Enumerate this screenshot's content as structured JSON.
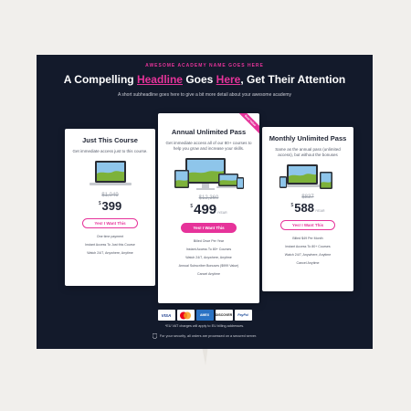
{
  "header": {
    "eyebrow": "AWESOME ACADEMY NAME GOES HERE",
    "headline_part1": "A Compelling ",
    "headline_highlight1": "Headline",
    "headline_part2": " Goes ",
    "headline_highlight2": "Here",
    "headline_part3": ", Get Their Attention",
    "subheadline": "A short subheadline goes here to give a bit more detail about your awesome academy"
  },
  "plans": [
    {
      "title": "Just This Course",
      "description": "Get immediate access just to this course.",
      "old_price": "$1,049",
      "currency": "$",
      "price": "399",
      "per": "",
      "button": "Yes! I Want This",
      "features": [
        "One time payment",
        "Instant Access To Just this Course",
        "Watch 24/7, Anywhere, Anytime"
      ]
    },
    {
      "title": "Annual Unlimited Pass",
      "description": "Get immediate access all of our 80+ courses to help you grow and increase your skills.",
      "old_price": "$12,360",
      "currency": "$",
      "price": "499",
      "per": "/YEAR",
      "button": "Yes! I Want This",
      "ribbon": "Best Value",
      "features": [
        "Billed Once Per Year",
        "Instant Access To 80+ Courses",
        "Watch 24/7, Anywhere, Anytime",
        "Annual Subscriber Bonuses ($999 Value)",
        "Cancel Anytime"
      ]
    },
    {
      "title": "Monthly Unlimited Pass",
      "description": "Same as the annual pass (unlimited access), but without the bonuses",
      "old_price": "$837",
      "currency": "$",
      "price": "588",
      "per": "/YEAR",
      "button": "Yes! I Want This",
      "features": [
        "Billed $49 Per Month",
        "Instant Access To 80+ Courses",
        "Watch 24/7, Anywhere, Anytime",
        "Cancel Anytime"
      ]
    }
  ],
  "payments": {
    "visa": "VISA",
    "amex": "AMEX",
    "discover": "DISCOVER",
    "paypal": "PayPal"
  },
  "footer": {
    "vat_note": "*EU VAT charges will apply to EU billing addresses.",
    "secure_note": "For your security, all orders are processed on a secured server."
  },
  "colors": {
    "accent": "#e6339a",
    "panel": "#131a2b",
    "page_bg": "#f1efec"
  }
}
